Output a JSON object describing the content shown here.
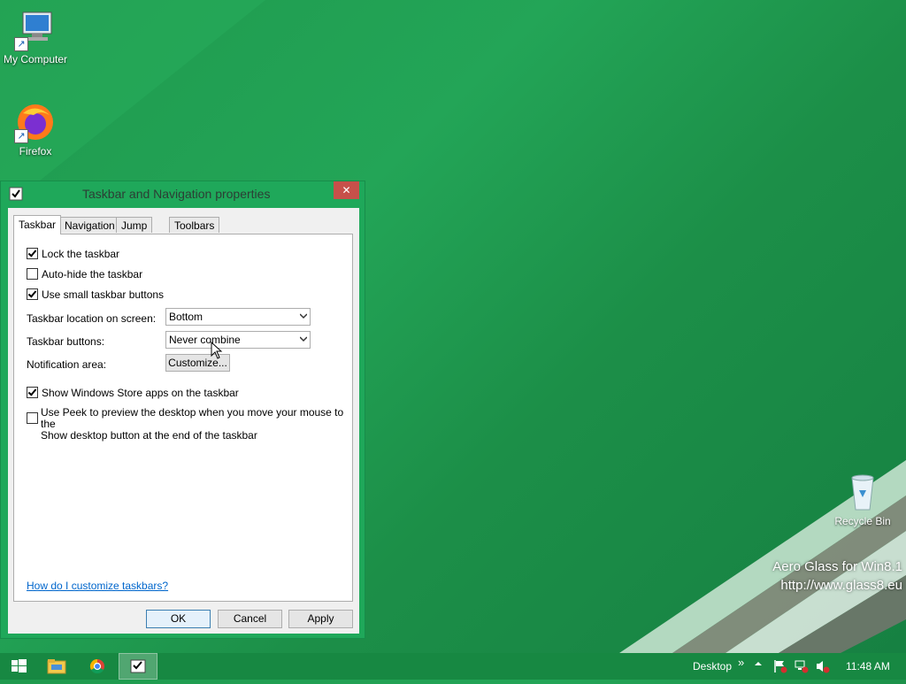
{
  "desktop": {
    "icons": {
      "my_computer": "My Computer",
      "firefox": "Firefox",
      "recycle_bin": "Recycle Bin"
    },
    "watermark_line1": "Aero Glass for Win8.1",
    "watermark_line2": "http://www.glass8.eu"
  },
  "dialog": {
    "title": "Taskbar and Navigation properties",
    "close": "✕",
    "tabs": [
      "Taskbar",
      "Navigation",
      "Jump Lists",
      "Toolbars"
    ],
    "options": {
      "lock": "Lock the taskbar",
      "autohide": "Auto-hide the taskbar",
      "small_buttons": "Use small taskbar buttons",
      "store_apps": "Show Windows Store apps on the taskbar",
      "peek_line1": "Use Peek to preview the desktop when you move your mouse to the",
      "peek_line2": "Show desktop button at the end of the taskbar"
    },
    "location_label": "Taskbar location on screen:",
    "location_value": "Bottom",
    "buttons_label": "Taskbar buttons:",
    "buttons_value": "Never combine",
    "notification_label": "Notification area:",
    "customize": "Customize...",
    "help_link": "How do I customize taskbars?",
    "ok": "OK",
    "cancel": "Cancel",
    "apply": "Apply"
  },
  "taskbar": {
    "desktop_label": "Desktop",
    "chevron": "»",
    "time": "11:48 AM"
  }
}
